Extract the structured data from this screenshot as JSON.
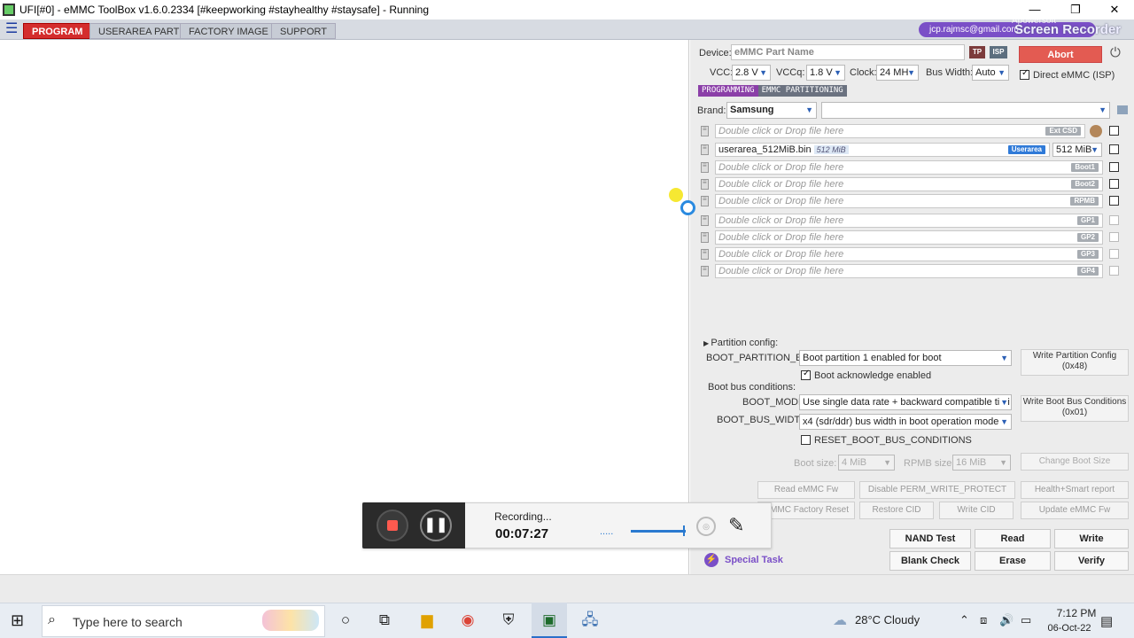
{
  "window": {
    "title": "UFI[#0] - eMMC ToolBox v1.6.0.2334 [#keepworking #stayhealthy #staysafe] - Running",
    "minimize": "—",
    "maximize": "❐",
    "close": "✕"
  },
  "menu": {
    "tabs": [
      "PROGRAM",
      "USERAREA PART",
      "FACTORY IMAGE",
      "SUPPORT"
    ],
    "user_email": "jcp.rajmsc@gmail.com"
  },
  "watermark": {
    "line1": "Apowersoft",
    "line2": "Screen Recorder"
  },
  "device": {
    "label": "Device:",
    "placeholder": "eMMC Part Name",
    "tp": "TP",
    "isp": "ISP",
    "abort": "Abort",
    "power": "⏻"
  },
  "settings": {
    "vcc_label": "VCC:",
    "vcc": "2.8 V",
    "vccq_label": "VCCq:",
    "vccq": "1.8 V",
    "clock_label": "Clock:",
    "clock": "24 MH",
    "bus_label": "Bus Width:",
    "bus": "Auto",
    "direct_label": "Direct eMMC (ISP)"
  },
  "mode_badges": [
    "PROGRAMMING",
    "EMMC PARTITIONING"
  ],
  "brand": {
    "label": "Brand:",
    "value": "Samsung"
  },
  "partitions": {
    "ext_csd": {
      "placeholder": "Double click or Drop file here",
      "badge": "Ext CSD"
    },
    "userarea": {
      "file": "userarea_512MiB.bin",
      "size_tag": "512 MiB",
      "badge": "Userarea",
      "size": "512 MiB"
    },
    "rows": [
      {
        "placeholder": "Double click or Drop file here",
        "badge": "Boot1"
      },
      {
        "placeholder": "Double click or Drop file here",
        "badge": "Boot2"
      },
      {
        "placeholder": "Double click or Drop file here",
        "badge": "RPMB"
      }
    ],
    "gp_rows": [
      {
        "placeholder": "Double click or Drop file here",
        "badge": "GP1"
      },
      {
        "placeholder": "Double click or Drop file here",
        "badge": "GP2"
      },
      {
        "placeholder": "Double click or Drop file here",
        "badge": "GP3"
      },
      {
        "placeholder": "Double click or Drop file here",
        "badge": "GP4"
      }
    ]
  },
  "partition_config": {
    "header": "Partition config:",
    "boot_partition_label": "BOOT_PARTITION_EN",
    "boot_partition_value": "Boot partition 1 enabled for boot",
    "boot_ack": "Boot acknowledge enabled",
    "write_config": "Write Partition Config",
    "write_config_code": "(0x48)",
    "bus_conditions": "Boot bus conditions:",
    "boot_mode_label": "BOOT_MODE",
    "boot_mode_value": "Use single data rate + backward compatible timi",
    "boot_bus_width_label": "BOOT_BUS_WIDTH",
    "boot_bus_width_value": "x4 (sdr/ddr) bus width in boot operation mode",
    "write_bus": "Write Boot Bus Conditions",
    "write_bus_code": "(0x01)",
    "reset_label": "RESET_BOOT_BUS_CONDITIONS",
    "boot_size_label": "Boot size:",
    "boot_size": "4 MiB",
    "rpmb_size_label": "RPMB size:",
    "rpmb_size": "16 MiB",
    "change_boot_size": "Change Boot Size"
  },
  "actions": {
    "read_fw": "Read eMMC Fw",
    "disable_perm": "Disable PERM_WRITE_PROTECT",
    "health": "Health+Smart report",
    "factory_reset": "eMMC Factory Reset",
    "restore_cid": "Restore CID",
    "write_cid": "Write CID",
    "update_fw": "Update eMMC Fw",
    "nand_test": "NAND Test",
    "read": "Read",
    "write": "Write",
    "blank_check": "Blank Check",
    "erase": "Erase",
    "verify": "Verify",
    "special_task": "Special Task"
  },
  "recorder": {
    "status": "Recording...",
    "time": "00:07:27",
    "dots": "....."
  },
  "taskbar": {
    "search_placeholder": "Type here to search",
    "weather": "28°C  Cloudy",
    "time": "7:12 PM",
    "date": "06-Oct-22"
  }
}
